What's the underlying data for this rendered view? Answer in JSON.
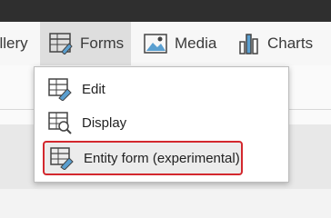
{
  "ribbon": {
    "tabs": [
      {
        "label": "allery",
        "icon": "gallery-icon"
      },
      {
        "label": "Forms",
        "icon": "form-grid-icon"
      },
      {
        "label": "Media",
        "icon": "image-icon"
      },
      {
        "label": "Charts",
        "icon": "bar-chart-icon"
      }
    ],
    "active_tab": "Forms"
  },
  "forms_menu": {
    "items": [
      {
        "label": "Edit",
        "icon": "form-edit-icon"
      },
      {
        "label": "Display",
        "icon": "form-display-icon"
      },
      {
        "label": "Entity form (experimental)",
        "icon": "form-entity-icon",
        "highlighted": true
      }
    ]
  },
  "colors": {
    "topbar": "#2f2f2f",
    "active_tab_bg": "#dedede",
    "icon_accent": "#5a9fd0",
    "highlight_border": "#d3282e"
  }
}
